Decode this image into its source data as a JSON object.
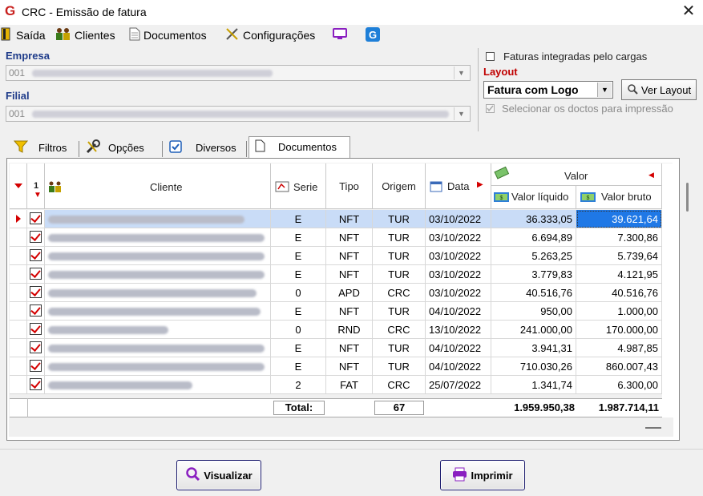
{
  "window": {
    "title": "CRC - Emissão de fatura",
    "app_logo": "G"
  },
  "menu": {
    "items": [
      {
        "label": "Saída",
        "icon": "exit-door-icon"
      },
      {
        "label": "Clientes",
        "icon": "clients-icon"
      },
      {
        "label": "Documentos",
        "icon": "document-icon"
      },
      {
        "label": "Configurações",
        "icon": "tools-icon"
      }
    ],
    "extra_icons": [
      "monitor-icon",
      "app-logo-icon"
    ]
  },
  "empresa": {
    "label": "Empresa",
    "value": "001"
  },
  "filial": {
    "label": "Filial",
    "value": "001"
  },
  "options": {
    "faturas_integradas": "Faturas integradas pelo cargas",
    "layout_label": "Layout",
    "layout_value": "Fatura com Logo",
    "ver_layout": "Ver Layout",
    "selecionar": "Selecionar os doctos para impressão"
  },
  "tabs": [
    {
      "label": "Filtros",
      "icon": "funnel-icon"
    },
    {
      "label": "Opções",
      "icon": "wrench-icon"
    },
    {
      "label": "Diversos",
      "icon": "checkbox-icon"
    },
    {
      "label": "Documentos",
      "icon": "page-icon"
    }
  ],
  "grid": {
    "headers": {
      "cliente": "Cliente",
      "serie": "Serie",
      "tipo": "Tipo",
      "origem": "Origem",
      "data": "Data",
      "valor": "Valor",
      "valor_liquido": "Valor líquido",
      "valor_bruto": "Valor bruto"
    },
    "sort_marker": "1",
    "rows": [
      {
        "serie": "E",
        "tipo": "NFT",
        "origem": "TUR",
        "data": "03/10/2022",
        "liquido": "36.333,05",
        "bruto": "39.621,64",
        "selected": true
      },
      {
        "serie": "E",
        "tipo": "NFT",
        "origem": "TUR",
        "data": "03/10/2022",
        "liquido": "6.694,89",
        "bruto": "7.300,86"
      },
      {
        "serie": "E",
        "tipo": "NFT",
        "origem": "TUR",
        "data": "03/10/2022",
        "liquido": "5.263,25",
        "bruto": "5.739,64"
      },
      {
        "serie": "E",
        "tipo": "NFT",
        "origem": "TUR",
        "data": "03/10/2022",
        "liquido": "3.779,83",
        "bruto": "4.121,95"
      },
      {
        "serie": "0",
        "tipo": "APD",
        "origem": "CRC",
        "data": "03/10/2022",
        "liquido": "40.516,76",
        "bruto": "40.516,76"
      },
      {
        "serie": "E",
        "tipo": "NFT",
        "origem": "TUR",
        "data": "04/10/2022",
        "liquido": "950,00",
        "bruto": "1.000,00"
      },
      {
        "serie": "0",
        "tipo": "RND",
        "origem": "CRC",
        "data": "13/10/2022",
        "liquido": "241.000,00",
        "bruto": "170.000,00"
      },
      {
        "serie": "E",
        "tipo": "NFT",
        "origem": "TUR",
        "data": "04/10/2022",
        "liquido": "3.941,31",
        "bruto": "4.987,85"
      },
      {
        "serie": "E",
        "tipo": "NFT",
        "origem": "TUR",
        "data": "04/10/2022",
        "liquido": "710.030,26",
        "bruto": "860.007,43"
      },
      {
        "serie": "2",
        "tipo": "FAT",
        "origem": "CRC",
        "data": "25/07/2022",
        "liquido": "1.341,74",
        "bruto": "6.300,00"
      }
    ],
    "footer": {
      "label": "Total:",
      "count": "67",
      "liquido": "1.959.950,38",
      "bruto": "1.987.714,11"
    }
  },
  "buttons": {
    "visualizar": "Visualizar",
    "imprimir": "Imprimir"
  },
  "colors": {
    "accent_blue": "#1f3c8a",
    "selection": "#3d8ee8",
    "check_red": "#d40000"
  }
}
